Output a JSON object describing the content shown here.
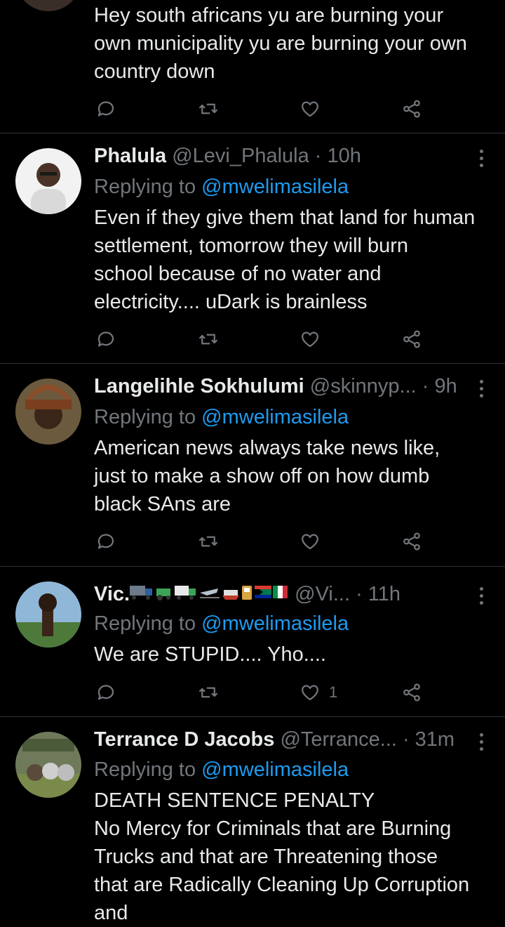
{
  "tweets": [
    {
      "name": "",
      "handle": "",
      "time": "",
      "replying_label": "",
      "replying_to": "",
      "text_lines": [
        "Hey south africans yu are burning your",
        "own municipality yu are burning your own",
        "country down"
      ],
      "likes": ""
    },
    {
      "name": "Phalula",
      "handle": "@Levi_Phalula",
      "time": "· 10h",
      "replying_label": "Replying to",
      "replying_to": "@mwelimasilela",
      "text_lines": [
        "Even if they give them that land for human",
        "settlement, tomorrow they will burn",
        "school because of no water and",
        "electricity.... uDark is brainless"
      ],
      "likes": ""
    },
    {
      "name": "Langelihle Sokhulumi",
      "handle": "@skinnyp...",
      "time": "· 9h",
      "replying_label": "Replying to",
      "replying_to": "@mwelimasilela",
      "text_lines": [
        "American news always take news like,",
        "just to make a show off on how dumb",
        "black SAns are"
      ],
      "likes": ""
    },
    {
      "name": "Vic.",
      "handle": "@Vi...",
      "time": "· 11h",
      "replying_label": "Replying to",
      "replying_to": "@mwelimasilela",
      "text_lines": [
        "We are STUPID.... Yho...."
      ],
      "likes": "1"
    },
    {
      "name": "Terrance D Jacobs",
      "handle": "@Terrance...",
      "time": "· 31m",
      "replying_label": "Replying to",
      "replying_to": "@mwelimasilela",
      "text_lines": [
        "DEATH SENTENCE PENALTY",
        "No Mercy for Criminals that are Burning",
        "Trucks and that are Threatening those",
        "that are Radically Cleaning Up Corruption",
        "and"
      ],
      "likes": ""
    }
  ],
  "icons": {
    "reply": "reply-icon",
    "retweet": "retweet-icon",
    "like": "heart-icon",
    "share": "share-icon",
    "more": "more-icon"
  },
  "colors": {
    "background": "#000000",
    "text": "#e7e9ea",
    "muted": "#71767b",
    "mention": "#1d9bf0",
    "divider": "#2f3336"
  }
}
